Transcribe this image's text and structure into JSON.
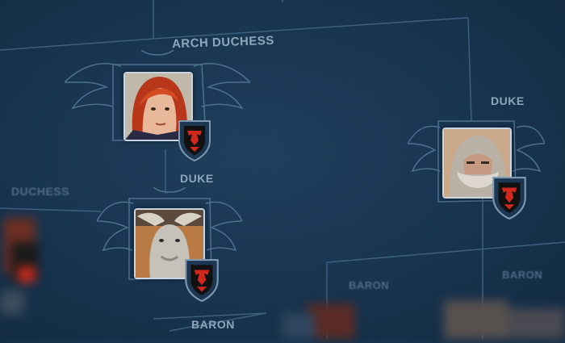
{
  "nodes": {
    "arch_duchess": {
      "title": "ARCH DUCHESS"
    },
    "duke_left": {
      "title": "DUKE"
    },
    "duke_right": {
      "title": "DUKE"
    },
    "duchess_edge": {
      "title": "DUCHESS"
    },
    "baron_mid": {
      "title": "BARON"
    },
    "baron_right": {
      "title": "BARON"
    },
    "baron_bottom": {
      "title": "BARON"
    }
  },
  "colors": {
    "background": "#18344f",
    "line": "#3d5f80",
    "title_text": "#8ea6bd",
    "shield_red": "#d0281c",
    "shield_black": "#111111"
  },
  "icons": {
    "crest": "winged-crest-frame",
    "emblem": "dragon-shield-emblem"
  }
}
